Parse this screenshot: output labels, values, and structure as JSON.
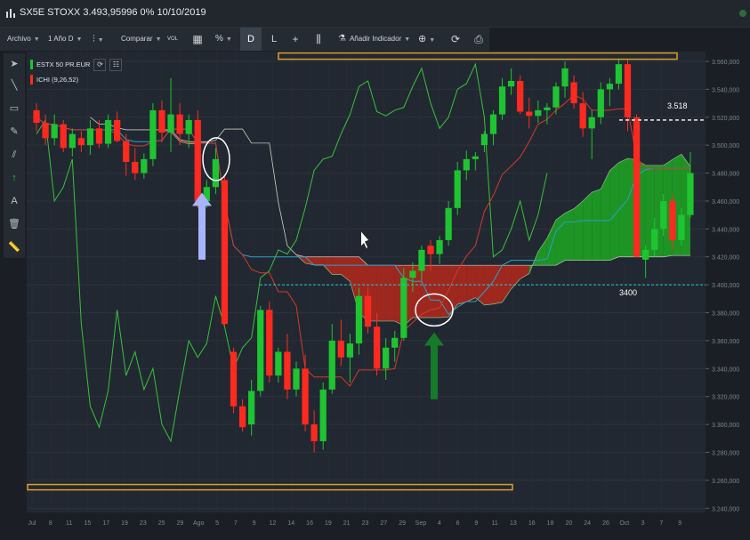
{
  "window": {
    "title": "SX5E STOXX 3.493,95996 0% 10/10/2019"
  },
  "toolbar": {
    "archivo": "Archivo",
    "period": "1 Año D",
    "comparar": "Comparar",
    "vol": "VOL",
    "percent": "%",
    "d": "D",
    "l": "L",
    "add_indicator": "Añadir Indicador"
  },
  "legend": {
    "series1": "ESTX 50 PR.EUR",
    "series2": "ICHI (9,26,52)"
  },
  "colors": {
    "up": "#1ec431",
    "down": "#ff2a1f",
    "kumo_bull": "#1f9a25",
    "kumo_bear": "#a6281e",
    "tenkan": "#d13a2b",
    "kijun": "#2aa0c9",
    "chikou": "#36c23b",
    "highlight": "#d9a02a",
    "arrow_up": "#a9b4ff",
    "arrow_green": "#157a2a",
    "dashed_white": "#ffffff",
    "dashed_cyan": "#27c7e0"
  },
  "annotations": {
    "level_3518": "3.518",
    "level_3400": "3400"
  },
  "chart_data": {
    "type": "candlestick",
    "title": "",
    "y_ticks": [
      "3.560,000",
      "3.540,000",
      "3.520,000",
      "3.500,000",
      "3.480,000",
      "3.460,000",
      "3.440,000",
      "3.420,000",
      "3.400,000",
      "3.380,000",
      "3.360,000",
      "3.340,000",
      "3.320,000",
      "3.300,000",
      "3.280,000",
      "3.260,000",
      "3.240,000"
    ],
    "ylim": [
      3237,
      3567
    ],
    "x_ticks": [
      "Jul",
      "8",
      "11",
      "15",
      "17",
      "19",
      "23",
      "25",
      "29",
      "Ago",
      "5",
      "7",
      "9",
      "12",
      "14",
      "16",
      "19",
      "21",
      "23",
      "27",
      "29",
      "Sep",
      "4",
      "6",
      "9",
      "11",
      "13",
      "16",
      "18",
      "20",
      "24",
      "26",
      "Oct",
      "3",
      "7",
      "9"
    ],
    "candles": [
      [
        3525,
        3530,
        3510,
        3516
      ],
      [
        3516,
        3522,
        3500,
        3505
      ],
      [
        3505,
        3522,
        3500,
        3515
      ],
      [
        3515,
        3518,
        3495,
        3498
      ],
      [
        3498,
        3512,
        3492,
        3508
      ],
      [
        3505,
        3510,
        3495,
        3500
      ],
      [
        3500,
        3518,
        3493,
        3512
      ],
      [
        3512,
        3518,
        3498,
        3501
      ],
      [
        3501,
        3522,
        3498,
        3518
      ],
      [
        3518,
        3524,
        3502,
        3503
      ],
      [
        3503,
        3508,
        3478,
        3488
      ],
      [
        3488,
        3498,
        3475,
        3480
      ],
      [
        3480,
        3494,
        3476,
        3490
      ],
      [
        3490,
        3530,
        3485,
        3525
      ],
      [
        3525,
        3532,
        3502,
        3509
      ],
      [
        3509,
        3548,
        3495,
        3522
      ],
      [
        3522,
        3530,
        3500,
        3508
      ],
      [
        3508,
        3522,
        3498,
        3518
      ],
      [
        3518,
        3525,
        3455,
        3460
      ],
      [
        3460,
        3475,
        3455,
        3470
      ],
      [
        3470,
        3498,
        3465,
        3490
      ],
      [
        3475,
        3478,
        3370,
        3372
      ],
      [
        3352,
        3355,
        3308,
        3313
      ],
      [
        3313,
        3318,
        3295,
        3298
      ],
      [
        3300,
        3332,
        3292,
        3324
      ],
      [
        3324,
        3385,
        3320,
        3382
      ],
      [
        3382,
        3388,
        3330,
        3335
      ],
      [
        3335,
        3355,
        3330,
        3352
      ],
      [
        3352,
        3365,
        3318,
        3325
      ],
      [
        3325,
        3345,
        3320,
        3340
      ],
      [
        3340,
        3350,
        3295,
        3300
      ],
      [
        3300,
        3310,
        3280,
        3288
      ],
      [
        3288,
        3330,
        3282,
        3325
      ],
      [
        3325,
        3372,
        3322,
        3360
      ],
      [
        3360,
        3375,
        3342,
        3348
      ],
      [
        3348,
        3365,
        3330,
        3358
      ],
      [
        3358,
        3398,
        3350,
        3392
      ],
      [
        3392,
        3398,
        3365,
        3370
      ],
      [
        3370,
        3380,
        3335,
        3340
      ],
      [
        3340,
        3362,
        3332,
        3355
      ],
      [
        3355,
        3367,
        3345,
        3362
      ],
      [
        3362,
        3412,
        3360,
        3405
      ],
      [
        3405,
        3416,
        3395,
        3410
      ],
      [
        3410,
        3428,
        3403,
        3425
      ],
      [
        3428,
        3432,
        3410,
        3422
      ],
      [
        3422,
        3435,
        3415,
        3432
      ],
      [
        3432,
        3460,
        3428,
        3455
      ],
      [
        3455,
        3488,
        3450,
        3482
      ],
      [
        3482,
        3496,
        3475,
        3490
      ],
      [
        3490,
        3495,
        3482,
        3492
      ],
      [
        3500,
        3510,
        3495,
        3508
      ],
      [
        3508,
        3525,
        3500,
        3522
      ],
      [
        3522,
        3548,
        3518,
        3542
      ],
      [
        3542,
        3555,
        3536,
        3546
      ],
      [
        3546,
        3550,
        3522,
        3524
      ],
      [
        3524,
        3534,
        3512,
        3521
      ],
      [
        3521,
        3532,
        3516,
        3525
      ],
      [
        3525,
        3530,
        3515,
        3527
      ],
      [
        3527,
        3545,
        3522,
        3542
      ],
      [
        3542,
        3560,
        3534,
        3555
      ],
      [
        3545,
        3550,
        3526,
        3530
      ],
      [
        3530,
        3538,
        3506,
        3512
      ],
      [
        3512,
        3525,
        3490,
        3520
      ],
      [
        3520,
        3545,
        3515,
        3540
      ],
      [
        3540,
        3548,
        3528,
        3544
      ],
      [
        3544,
        3562,
        3540,
        3558
      ],
      [
        3558,
        3562,
        3510,
        3520
      ],
      [
        3520,
        3522,
        3420,
        3420
      ],
      [
        3418,
        3428,
        3405,
        3425
      ],
      [
        3425,
        3448,
        3420,
        3440
      ],
      [
        3440,
        3465,
        3435,
        3460
      ],
      [
        3460,
        3465,
        3425,
        3432
      ],
      [
        3432,
        3455,
        3428,
        3450
      ],
      [
        3450,
        3495,
        3448,
        3480
      ]
    ],
    "series": [
      {
        "name": "ICHI (9,26,52)",
        "values": []
      }
    ],
    "levels": [
      {
        "label": "3.518",
        "value": 3518
      },
      {
        "label": "3400",
        "value": 3400
      }
    ]
  }
}
